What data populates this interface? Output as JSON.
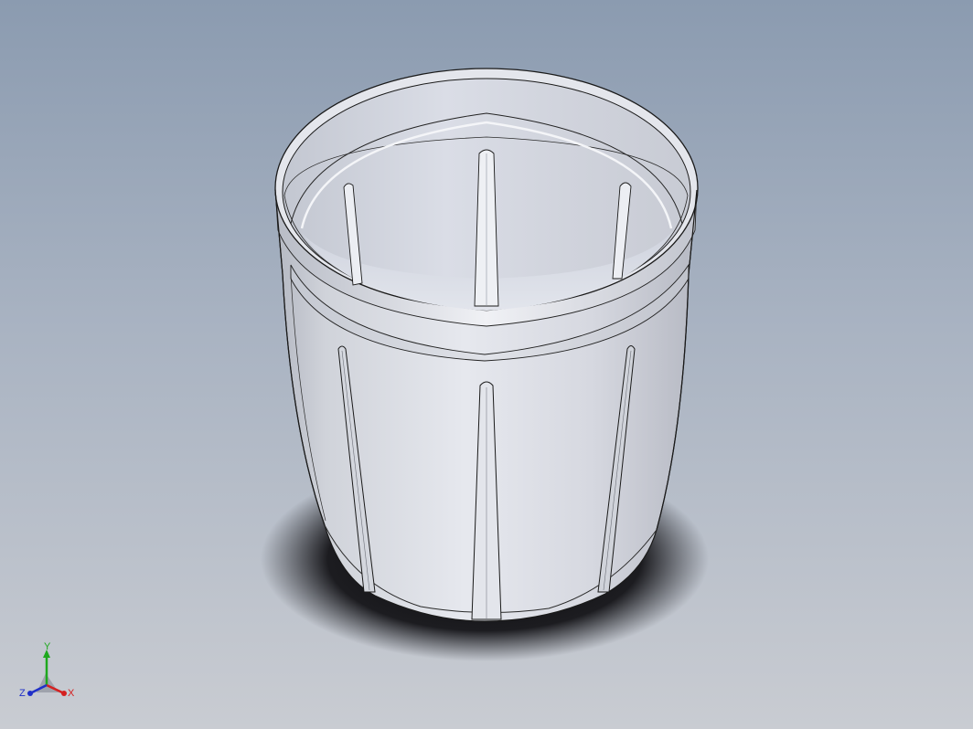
{
  "triad": {
    "x_label": "X",
    "y_label": "Y",
    "z_label": "Z",
    "x_color": "#d42020",
    "y_color": "#1ea81e",
    "z_color": "#2030c8"
  },
  "colors": {
    "background_top": "#8b9bb0",
    "background_bottom": "#c9ccd2",
    "body": "#d9dbe1",
    "shadow": "#16161a"
  },
  "icons": {
    "model": "cylindrical-basket-model",
    "triad": "reference-triad-icon"
  }
}
